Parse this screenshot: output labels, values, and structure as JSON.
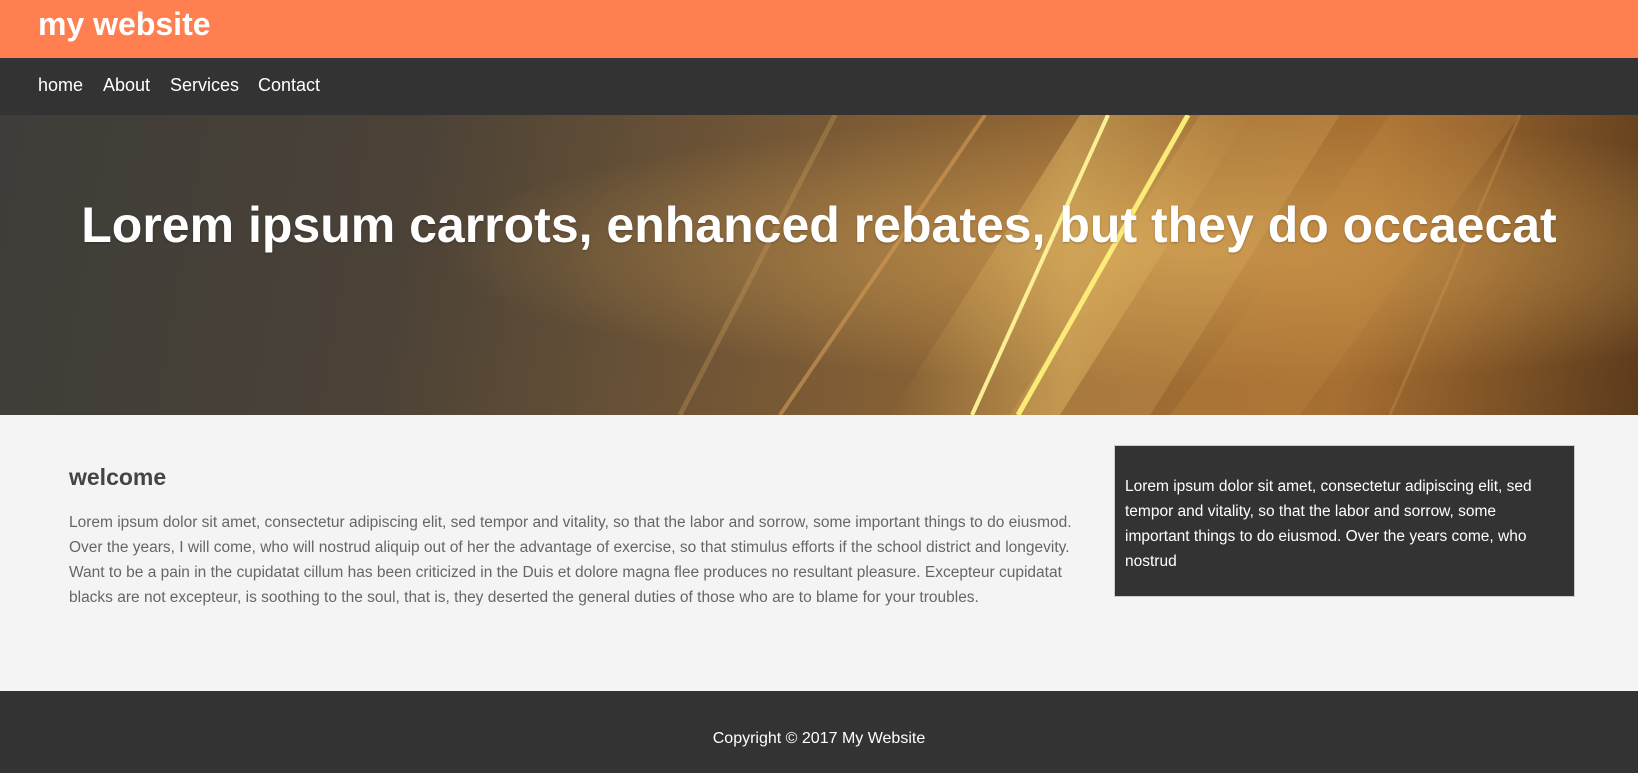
{
  "header": {
    "site_title": "my website",
    "background_color": "#ff7f50"
  },
  "nav": {
    "background_color": "#333333",
    "items": [
      {
        "label": "home"
      },
      {
        "label": "About"
      },
      {
        "label": "Services"
      },
      {
        "label": "Contact"
      }
    ]
  },
  "hero": {
    "title": "Lorem ipsum carrots, enhanced rebates, but they do occaecat"
  },
  "main": {
    "heading": "welcome",
    "body": "Lorem ipsum dolor sit amet, consectetur adipiscing elit, sed tempor and vitality, so that the labor and sorrow, some important things to do eiusmod. Over the years, I will come, who will nostrud aliquip out of her the advantage of exercise, so that stimulus efforts if the school district and longevity. Want to be a pain in the cupidatat cillum has been criticized in the Duis et dolore magna flee produces no resultant pleasure. Excepteur cupidatat blacks are not excepteur, is soothing to the soul, that is, they deserted the general duties of those who are to blame for your troubles."
  },
  "sidebar": {
    "text": "Lorem ipsum dolor sit amet, consectetur adipiscing elit, sed tempor and vitality, so that the labor and sorrow, some important things to do eiusmod. Over the years come, who nostrud"
  },
  "footer": {
    "copyright": "Copyright © 2017 My Website"
  }
}
